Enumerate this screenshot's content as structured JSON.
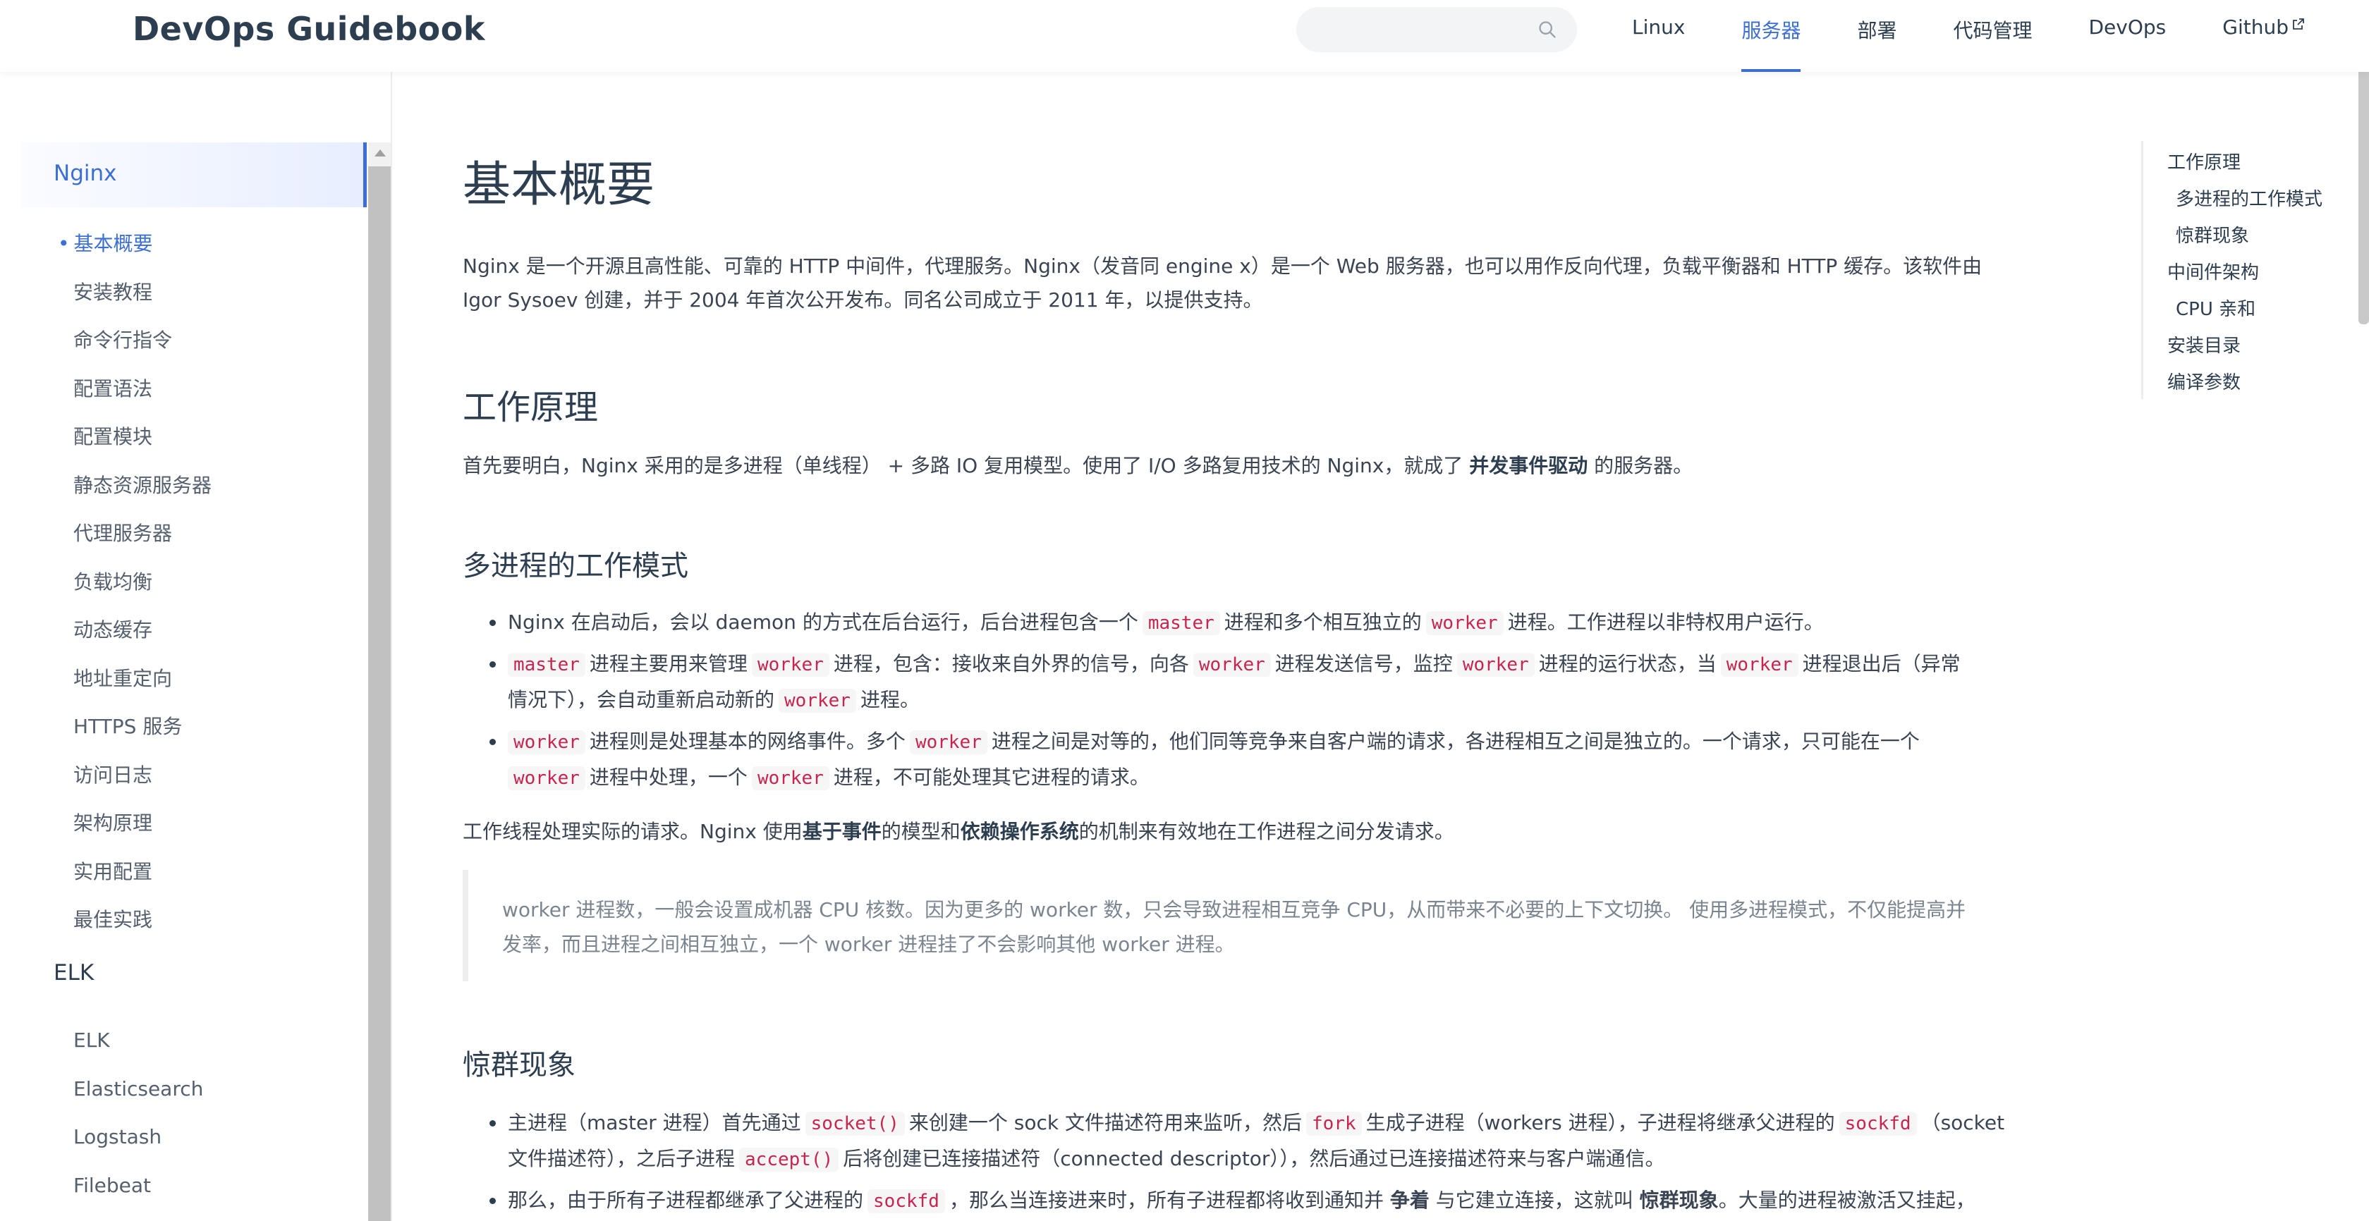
{
  "navbar": {
    "brand": "DevOps Guidebook",
    "search_placeholder": "",
    "links": [
      {
        "label": "Linux",
        "active": false
      },
      {
        "label": "服务器",
        "active": true
      },
      {
        "label": "部署",
        "active": false
      },
      {
        "label": "代码管理",
        "active": false
      },
      {
        "label": "DevOps",
        "active": false
      },
      {
        "label": "Github",
        "active": false,
        "external": true
      }
    ]
  },
  "sidebar": {
    "groups": [
      {
        "title": "Nginx",
        "active": true,
        "items": [
          "基本概要",
          "安装教程",
          "命令行指令",
          "配置语法",
          "配置模块",
          "静态资源服务器",
          "代理服务器",
          "负载均衡",
          "动态缓存",
          "地址重定向",
          "HTTPS 服务",
          "访问日志",
          "架构原理",
          "实用配置",
          "最佳实践"
        ],
        "active_item": 0
      },
      {
        "title": "ELK",
        "active": false,
        "items": [
          "ELK",
          "Elasticsearch",
          "Logstash",
          "Filebeat"
        ]
      }
    ]
  },
  "content": {
    "title": "基本概要",
    "intro_line1": "Nginx 是一个开源且高性能、可靠的 HTTP 中间件，代理服务。Nginx（发音同 engine x）是一个 Web 服务器，也可以用作反向代理，负载平衡器和 HTTP 缓存。该软件由",
    "intro_line2": "Igor Sysoev 创建，并于 2004 年首次公开发布。同名公司成立于 2011 年，以提供支持。",
    "h2_work": "工作原理",
    "work_pre": "首先要明白，Nginx 采用的是多进程（单线程） + 多路 IO 复用模型。使用了 I/O 多路复用技术的 Nginx，就成了 ",
    "work_bold": "并发事件驱动",
    "work_post": " 的服务器。",
    "h3_multi": "多进程的工作模式",
    "code_master": "master",
    "code_worker": "worker",
    "li1_a": "Nginx 在启动后，会以 daemon 的方式在后台运行，后台进程包含一个",
    "li1_b": "进程和多个相互独立的",
    "li1_c": "进程。工作进程以非特权用户运行。",
    "li2_a": "进程主要用来管理",
    "li2_b": "进程，包含：接收来自外界的信号，向各",
    "li2_c": "进程发送信号，监控",
    "li2_d": "进程的运行状态，当",
    "li2_e": "进程退出后（异常",
    "li2_f": "情况下），会自动重新启动新的",
    "li2_g": "进程。",
    "li3_a": "进程则是处理基本的网络事件。多个",
    "li3_b": "进程之间是对等的，他们同等竞争来自客户端的请求，各进程相互之间是独立的。一个请求，只可能在一个",
    "li3_c": "进程中处理，一个",
    "li3_d": "进程，不可能处理其它进程的请求。",
    "worker_para_a": "工作线程处理实际的请求。Nginx 使用",
    "worker_para_bold1": "基于事件",
    "worker_para_b": "的模型和",
    "worker_para_bold2": "依赖操作系统",
    "worker_para_c": "的机制来有效地在工作进程之间分发请求。",
    "quote_line1": "worker 进程数，一般会设置成机器 CPU 核数。因为更多的 worker 数，只会导致进程相互竞争 CPU，从而带来不必要的上下文切换。 使用多进程模式，不仅能提高并",
    "quote_line2": "发率，而且进程之间相互独立，一个 worker 进程挂了不会影响其他 worker 进程。",
    "h3_herd": "惊群现象",
    "code_socket": "socket()",
    "code_fork": "fork",
    "code_sockfd": "sockfd",
    "code_accept": "accept()",
    "herd1_a": "主进程（master 进程）首先通过",
    "herd1_b": "来创建一个 sock 文件描述符用来监听，然后",
    "herd1_c": "生成子进程（workers 进程），子进程将继承父进程的",
    "herd1_d": "（socket",
    "herd1_e": "文件描述符），之后子进程",
    "herd1_f": "后将创建已连接描述符（connected descriptor）），然后通过已连接描述符来与客户端通信。",
    "herd2_a": "那么，由于所有子进程都继承了父进程的",
    "herd2_b": "，那么当连接进来时，所有子进程都将收到通知并 ",
    "herd2_bold1": "争着",
    "herd2_c": " 与它建立连接，这就叫 ",
    "herd2_bold2": "惊群现象",
    "herd2_d": "。大量的进程被激活又挂起，"
  },
  "toc": {
    "items": [
      {
        "label": "工作原理",
        "sub": false
      },
      {
        "label": "多进程的工作模式",
        "sub": true
      },
      {
        "label": "惊群现象",
        "sub": true
      },
      {
        "label": "中间件架构",
        "sub": false
      },
      {
        "label": "CPU 亲和",
        "sub": true
      },
      {
        "label": "安装目录",
        "sub": false
      },
      {
        "label": "编译参数",
        "sub": false
      }
    ]
  },
  "colors": {
    "accent": "#3c6fd6",
    "code": "#c7254e",
    "text": "#2c3e50"
  }
}
